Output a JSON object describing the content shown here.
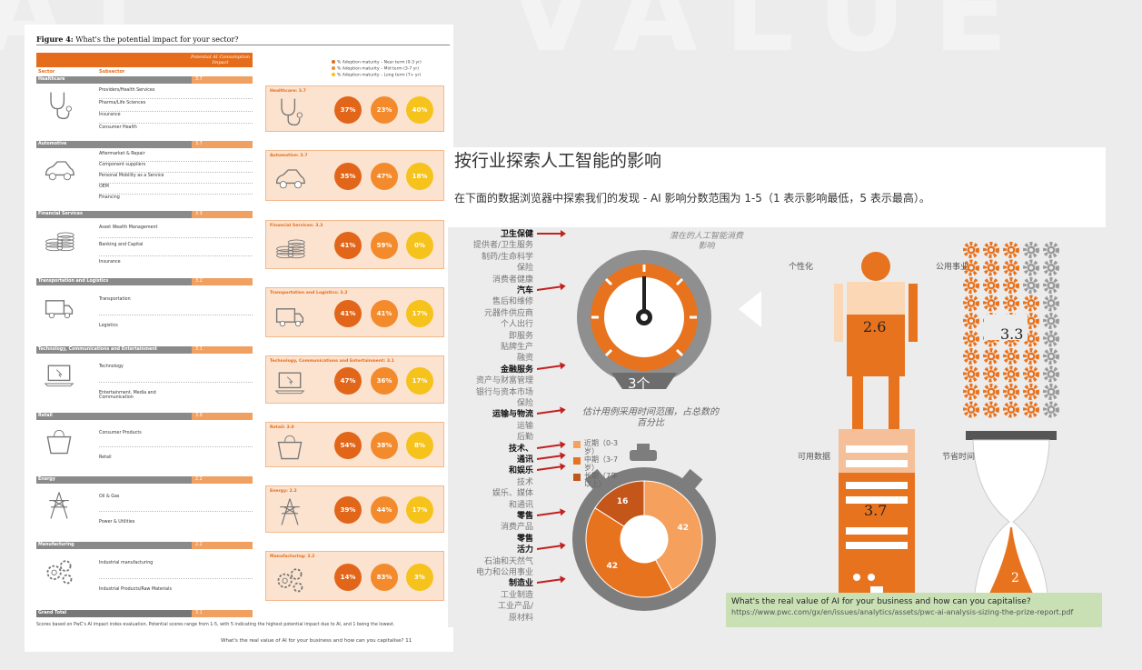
{
  "left_page": {
    "figure_label": "Figure 4:",
    "figure_title": "What's the potential impact for your sector?",
    "header_impact": "Potential AI Consumption Impact",
    "col_sector": "Sector",
    "col_subsector": "Subsector",
    "legend": [
      {
        "label": "% Adoption maturity – Near term (0-3 yr)",
        "color": "#e2661a"
      },
      {
        "label": "% Adoption maturity – Mid term (3-7 yr)",
        "color": "#f38b2c"
      },
      {
        "label": "% Adoption maturity – Long term (7+ yr)",
        "color": "#f6c21c"
      }
    ],
    "sectors": [
      {
        "name": "Healthcare",
        "score": "3.7",
        "icon": "stethoscope-icon",
        "subsectors": [
          "Providers/Health Services",
          "Pharma/Life Sciences",
          "Insurance",
          "Consumer Health"
        ],
        "card_title": "Healthcare: 3.7",
        "near": "37%",
        "mid": "23%",
        "long": "40%"
      },
      {
        "name": "Automotive",
        "score": "3.7",
        "icon": "car-icon",
        "subsectors": [
          "Aftermarket & Repair",
          "Component suppliers",
          "Personal Mobility as a Service",
          "OEM",
          "Financing"
        ],
        "card_title": "Automotive: 3.7",
        "near": "35%",
        "mid": "47%",
        "long": "18%"
      },
      {
        "name": "Financial Services",
        "score": "3.3",
        "icon": "coins-icon",
        "subsectors": [
          "Asset Wealth Management",
          "Banking and Capital",
          "Insurance"
        ],
        "card_title": "Financial Services: 3.3",
        "near": "41%",
        "mid": "59%",
        "long": "0%"
      },
      {
        "name": "Transportation and Logistics",
        "score": "3.2",
        "icon": "truck-icon",
        "subsectors": [
          "Transportation",
          "Logistics"
        ],
        "card_title": "Transportation and Logistics: 3.2",
        "near": "41%",
        "mid": "41%",
        "long": "17%"
      },
      {
        "name": "Technology, Communications and Entertainment",
        "score": "3.1",
        "icon": "laptop-icon",
        "subsectors": [
          "Technology",
          "Entertainment, Media and Communication"
        ],
        "card_title": "Technology, Communications and Entertainment: 3.1",
        "near": "47%",
        "mid": "36%",
        "long": "17%"
      },
      {
        "name": "Retail",
        "score": "3.0",
        "icon": "shopping-bag-icon",
        "subsectors": [
          "Consumer Products",
          "Retail"
        ],
        "card_title": "Retail: 3.0",
        "near": "54%",
        "mid": "38%",
        "long": "8%"
      },
      {
        "name": "Energy",
        "score": "2.2",
        "icon": "pylon-icon",
        "subsectors": [
          "Oil & Gas",
          "Power & Utilities"
        ],
        "card_title": "Energy: 2.2",
        "near": "39%",
        "mid": "44%",
        "long": "17%"
      },
      {
        "name": "Manufacturing",
        "score": "2.2",
        "icon": "gears-icon",
        "subsectors": [
          "Industrial manufacturing",
          "Industrial Products/Raw Materials"
        ],
        "card_title": "Manufacturing: 2.2",
        "near": "14%",
        "mid": "83%",
        "long": "3%"
      }
    ],
    "grand_total_label": "Grand Total",
    "grand_total_score": "3.1",
    "footnote": "Scores based on PwC's AI impact index evaluation. Potential scores range from 1-5, with 5 indicating the highest potential impact due to AI, and 1 being the lowest.",
    "page_footer": "What's the real value of AI for your business and how can you capitalise?   11"
  },
  "right_panel": {
    "title": "按行业探索人工智能的影响",
    "intro": "在下面的数据浏览器中探索我们的发现 - AI 影响分数范围为 1-5（1 表示影响最低，5 表示最高）。",
    "categories": [
      {
        "text": "卫生保健",
        "bold": true
      },
      {
        "text": "提供者/卫生服务",
        "bold": false
      },
      {
        "text": "制药/生命科学",
        "bold": false
      },
      {
        "text": "保险",
        "bold": false
      },
      {
        "text": "消费者健康",
        "bold": false
      },
      {
        "text": "汽车",
        "bold": true
      },
      {
        "text": "售后和维修",
        "bold": false
      },
      {
        "text": "元器件供应商",
        "bold": false
      },
      {
        "text": "个人出行",
        "bold": false
      },
      {
        "text": "即服务",
        "bold": false
      },
      {
        "text": "贴牌生产",
        "bold": false
      },
      {
        "text": "融资",
        "bold": false
      },
      {
        "text": "金融服务",
        "bold": true
      },
      {
        "text": "资产与财富管理",
        "bold": false
      },
      {
        "text": "银行与资本市场",
        "bold": false
      },
      {
        "text": "保险",
        "bold": false
      },
      {
        "text": "运输与物流",
        "bold": true
      },
      {
        "text": "运输",
        "bold": false
      },
      {
        "text": "后勤",
        "bold": false
      },
      {
        "text": "技术、",
        "bold": true
      },
      {
        "text": "通讯",
        "bold": true
      },
      {
        "text": "和娱乐",
        "bold": true
      },
      {
        "text": "技术",
        "bold": false
      },
      {
        "text": "娱乐、媒体",
        "bold": false
      },
      {
        "text": "和通讯",
        "bold": false
      },
      {
        "text": "零售",
        "bold": true
      },
      {
        "text": "消费产品",
        "bold": false
      },
      {
        "text": "零售",
        "bold": true
      },
      {
        "text": "活力",
        "bold": true
      },
      {
        "text": "石油和天然气",
        "bold": false
      },
      {
        "text": "电力和公用事业",
        "bold": false
      },
      {
        "text": "制造业",
        "bold": true
      },
      {
        "text": "工业制造",
        "bold": false
      },
      {
        "text": "工业产品/",
        "bold": false
      },
      {
        "text": "原材料",
        "bold": false
      }
    ],
    "gauge_label": "潜在的人工智能消费影响",
    "gauge_value": 3,
    "gauge_value_label": "3个",
    "donut_label": "估计用例采用时间范围，占总数的百分比",
    "donut_legend": [
      {
        "text": "近期（0-3岁）",
        "color": "#f5a05c"
      },
      {
        "text": "中期（3-7岁）",
        "color": "#e8731e"
      },
      {
        "text": "长期（7年以上）",
        "color": "#c4561a"
      }
    ],
    "labels": {
      "personalisation": "个性化",
      "utility": "公用事业",
      "data": "可用数据",
      "time": "节省时间"
    },
    "body_value": "2.6",
    "gear_value": "3.3",
    "server_value": "3.7",
    "hourglass_value": "2",
    "caption_title": "What's the real value of AI for your business and how can you capitalise?",
    "caption_url": "https://www.pwc.com/gx/en/issues/analytics/assets/pwc-ai-analysis-sizing-the-prize-report.pdf"
  },
  "chart_data": [
    {
      "type": "table",
      "title": "What's the potential impact for your sector?",
      "columns": [
        "Sector",
        "Potential AI Consumption Impact",
        "Near term (0-3 yr)",
        "Mid term (3-7 yr)",
        "Long term (7+ yr)"
      ],
      "rows": [
        [
          "Healthcare",
          3.7,
          37,
          23,
          40
        ],
        [
          "Automotive",
          3.7,
          35,
          47,
          18
        ],
        [
          "Financial Services",
          3.3,
          41,
          59,
          0
        ],
        [
          "Transportation and Logistics",
          3.2,
          41,
          41,
          17
        ],
        [
          "Technology, Communications and Entertainment",
          3.1,
          47,
          36,
          17
        ],
        [
          "Retail",
          3.0,
          54,
          38,
          8
        ],
        [
          "Energy",
          2.2,
          39,
          44,
          17
        ],
        [
          "Manufacturing",
          2.2,
          14,
          83,
          3
        ],
        [
          "Grand Total",
          3.1,
          null,
          null,
          null
        ]
      ]
    },
    {
      "type": "pie",
      "title": "估计用例采用时间范围，占总数的百分比",
      "categories": [
        "近期（0-3岁）",
        "中期（3-7岁）",
        "长期（7年以上）"
      ],
      "values": [
        42,
        42,
        16
      ]
    }
  ]
}
